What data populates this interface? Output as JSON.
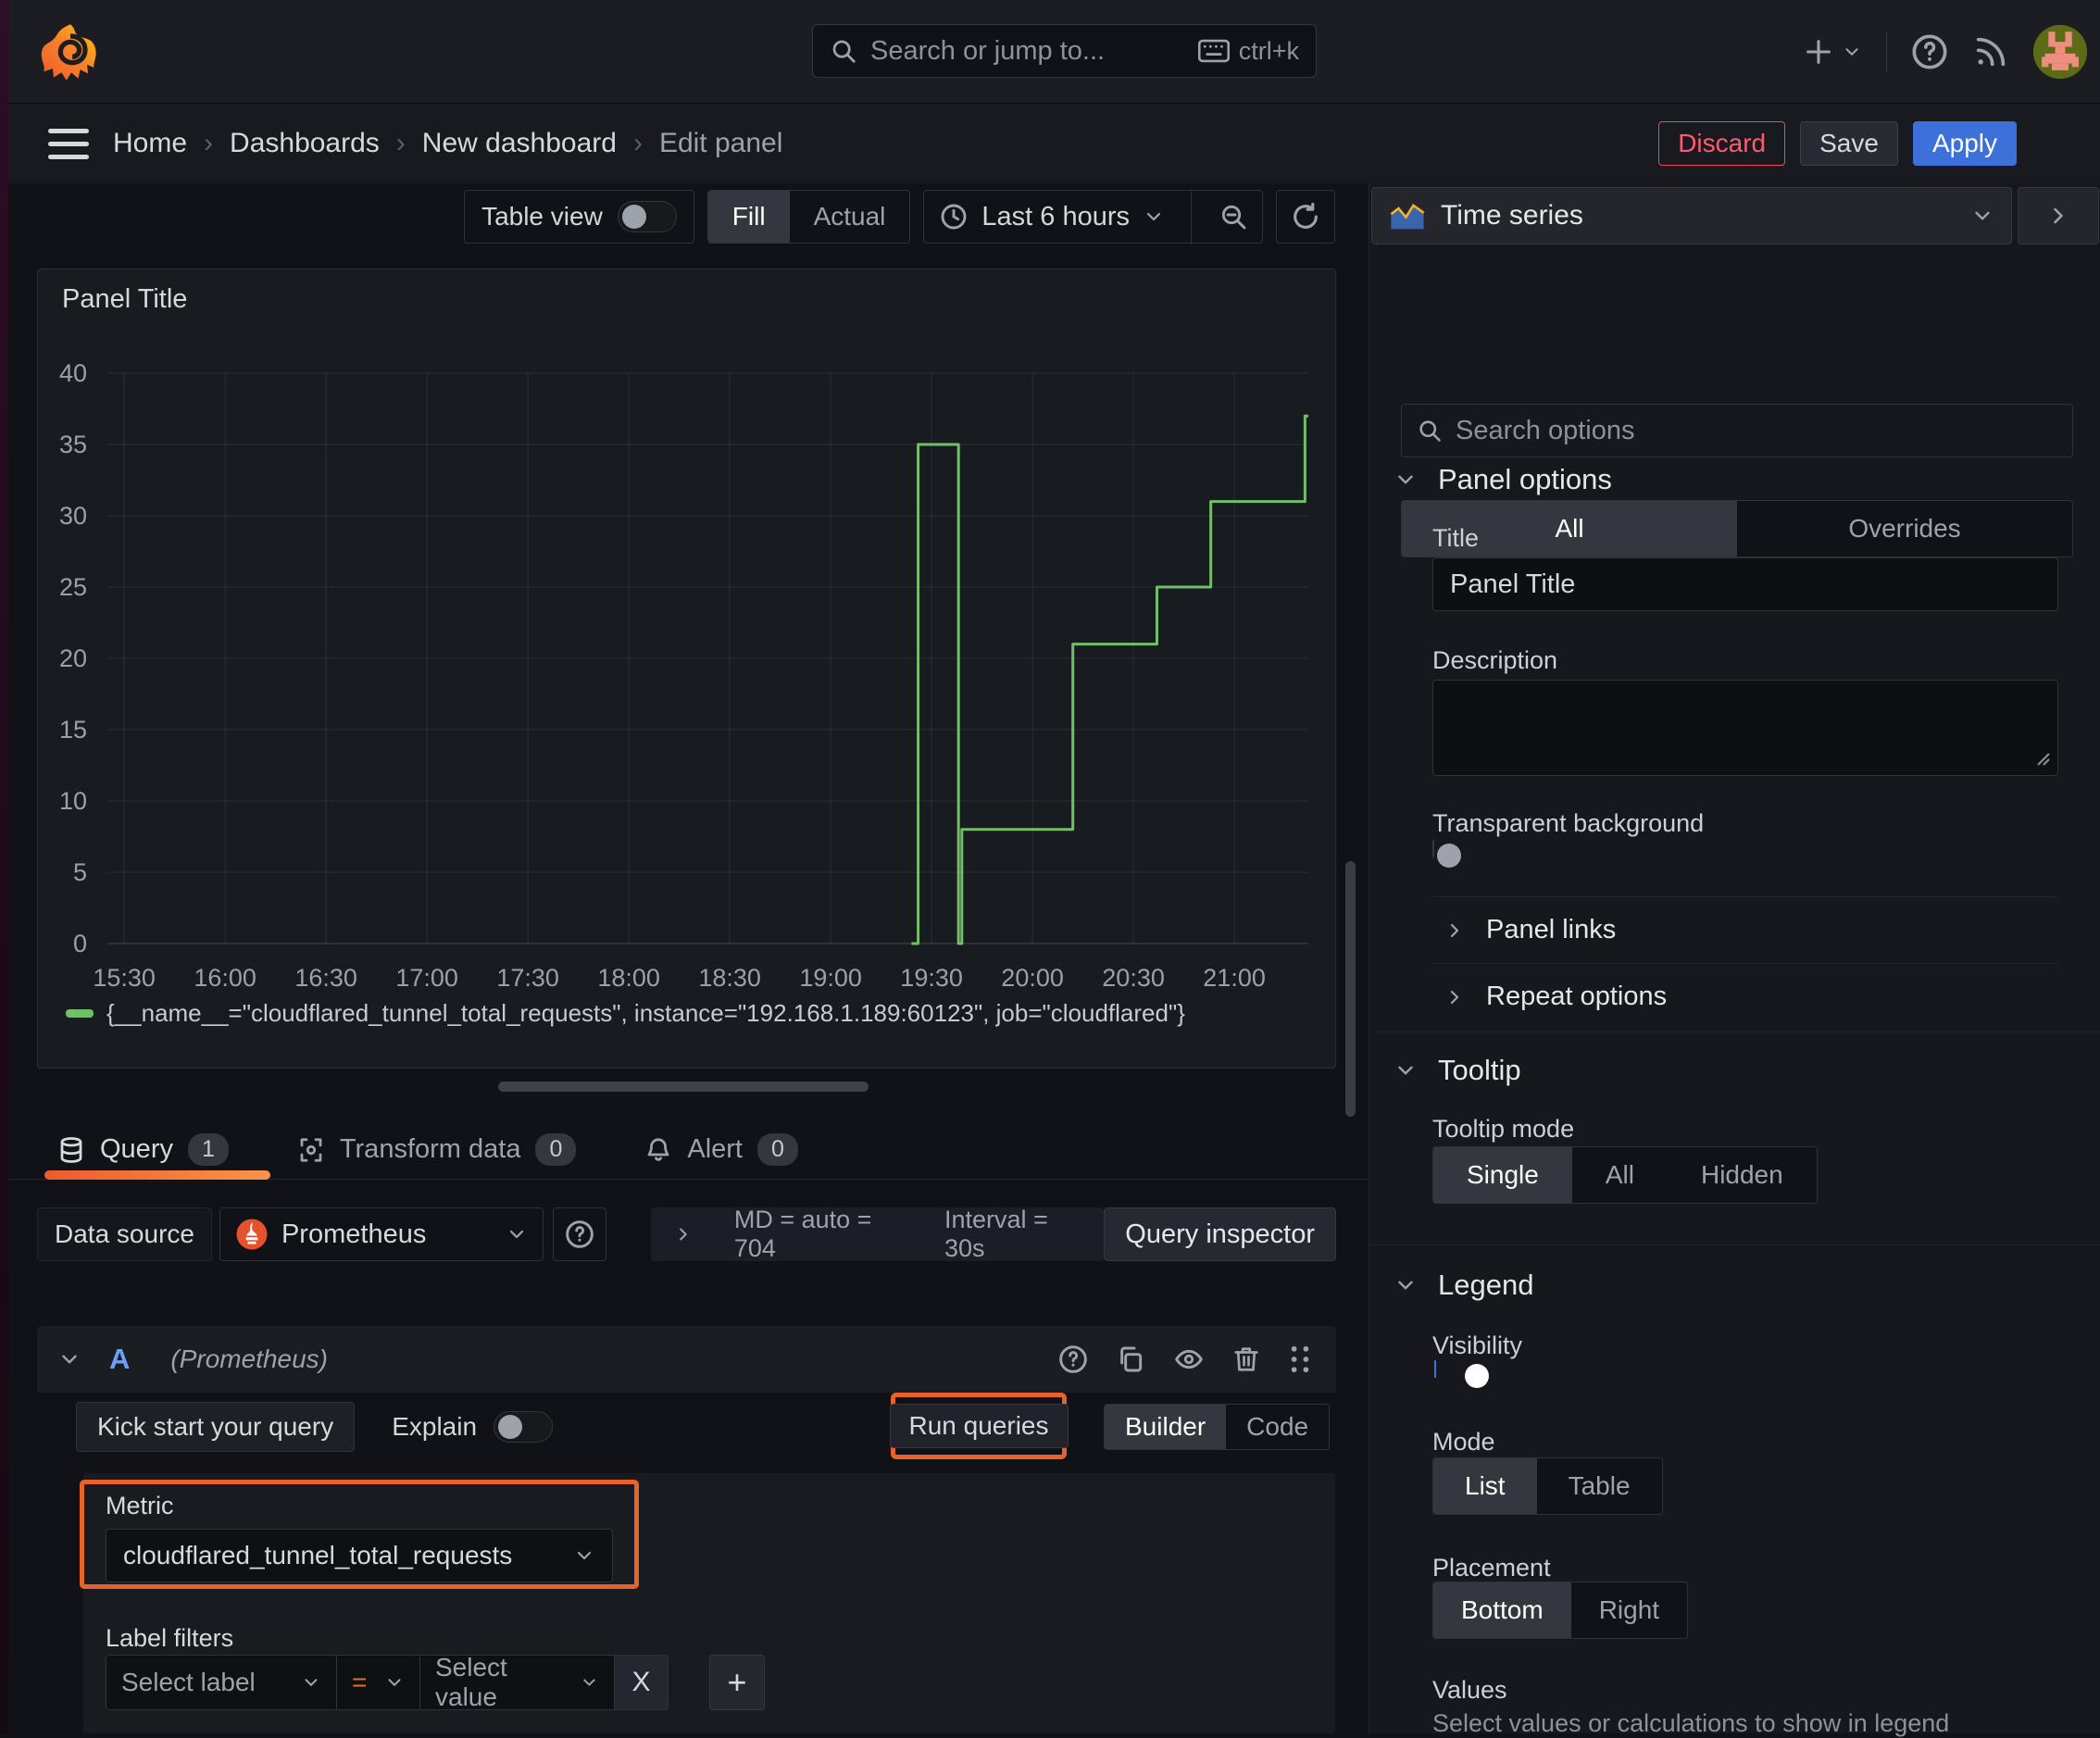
{
  "topbar": {
    "search": {
      "placeholder": "Search or jump to...",
      "shortcut": "ctrl+k"
    }
  },
  "breadcrumb": {
    "items": [
      "Home",
      "Dashboards",
      "New dashboard",
      "Edit panel"
    ]
  },
  "actions": {
    "discard": "Discard",
    "save": "Save",
    "apply": "Apply"
  },
  "toolbar": {
    "table_view_label": "Table view",
    "fill_label": "Fill",
    "actual_label": "Actual",
    "time_range": "Last 6 hours"
  },
  "viz_picker": {
    "type": "Time series"
  },
  "panel": {
    "title": "Panel Title"
  },
  "chart_data": {
    "type": "line",
    "line_style": "step-after",
    "title": "Panel Title",
    "x_domain": [
      "15:25",
      "21:22"
    ],
    "x_ticks": [
      "15:30",
      "16:00",
      "16:30",
      "17:00",
      "17:30",
      "18:00",
      "18:30",
      "19:00",
      "19:30",
      "20:00",
      "20:30",
      "21:00"
    ],
    "y_ticks": [
      0,
      5,
      10,
      15,
      20,
      25,
      30,
      35,
      40
    ],
    "ylim": [
      0,
      40
    ],
    "grid": true,
    "legend_position": "bottom",
    "series": [
      {
        "name": "{__name__=\"cloudflared_tunnel_total_requests\", instance=\"192.168.1.189:60123\", job=\"cloudflared\"}",
        "color": "#73bf69",
        "points": [
          [
            "19:24",
            0
          ],
          [
            "19:26",
            35
          ],
          [
            "19:38",
            0
          ],
          [
            "19:39",
            8
          ],
          [
            "20:12",
            21
          ],
          [
            "20:37",
            25
          ],
          [
            "20:53",
            31
          ],
          [
            "21:21",
            37
          ]
        ]
      }
    ]
  },
  "query_tabs": {
    "query": "Query",
    "query_count": "1",
    "transform": "Transform data",
    "transform_count": "0",
    "alert": "Alert",
    "alert_count": "0"
  },
  "datasource_row": {
    "label": "Data source",
    "name": "Prometheus",
    "summary_md": "MD = auto = 704",
    "summary_interval": "Interval = 30s",
    "query_inspector": "Query inspector"
  },
  "query_editor": {
    "ref_id": "A",
    "datasource_hint": "(Prometheus)",
    "kick_start": "Kick start your query",
    "explain": "Explain",
    "run_queries": "Run queries",
    "builder": "Builder",
    "code": "Code",
    "metric_label": "Metric",
    "metric_value": "cloudflared_tunnel_total_requests",
    "label_filters_label": "Label filters",
    "select_label_placeholder": "Select label",
    "operator": "=",
    "select_value_placeholder": "Select value",
    "remove_filter": "X",
    "add_filter": "+"
  },
  "options_sidebar": {
    "search_placeholder": "Search options",
    "tabs": {
      "all": "All",
      "overrides": "Overrides"
    },
    "panel_options": {
      "heading": "Panel options",
      "title_label": "Title",
      "title_value": "Panel Title",
      "description_label": "Description",
      "description_value": "",
      "transparent_label": "Transparent background"
    },
    "collapsed": {
      "panel_links": "Panel links",
      "repeat_options": "Repeat options"
    },
    "tooltip": {
      "heading": "Tooltip",
      "mode_label": "Tooltip mode",
      "modes": [
        "Single",
        "All",
        "Hidden"
      ],
      "selected_mode": "Single"
    },
    "legend": {
      "heading": "Legend",
      "visibility_label": "Visibility",
      "mode_label": "Mode",
      "modes": [
        "List",
        "Table"
      ],
      "selected_mode": "List",
      "placement_label": "Placement",
      "placements": [
        "Bottom",
        "Right"
      ],
      "selected_placement": "Bottom",
      "values_label": "Values",
      "values_hint": "Select values or calculations to show in legend"
    }
  },
  "colors": {
    "accent_orange": "#e8622a",
    "apply_blue": "#3d71d9",
    "discard_red": "#f2495c",
    "series_green": "#73bf69",
    "ref_id_blue": "#6e9fff"
  }
}
